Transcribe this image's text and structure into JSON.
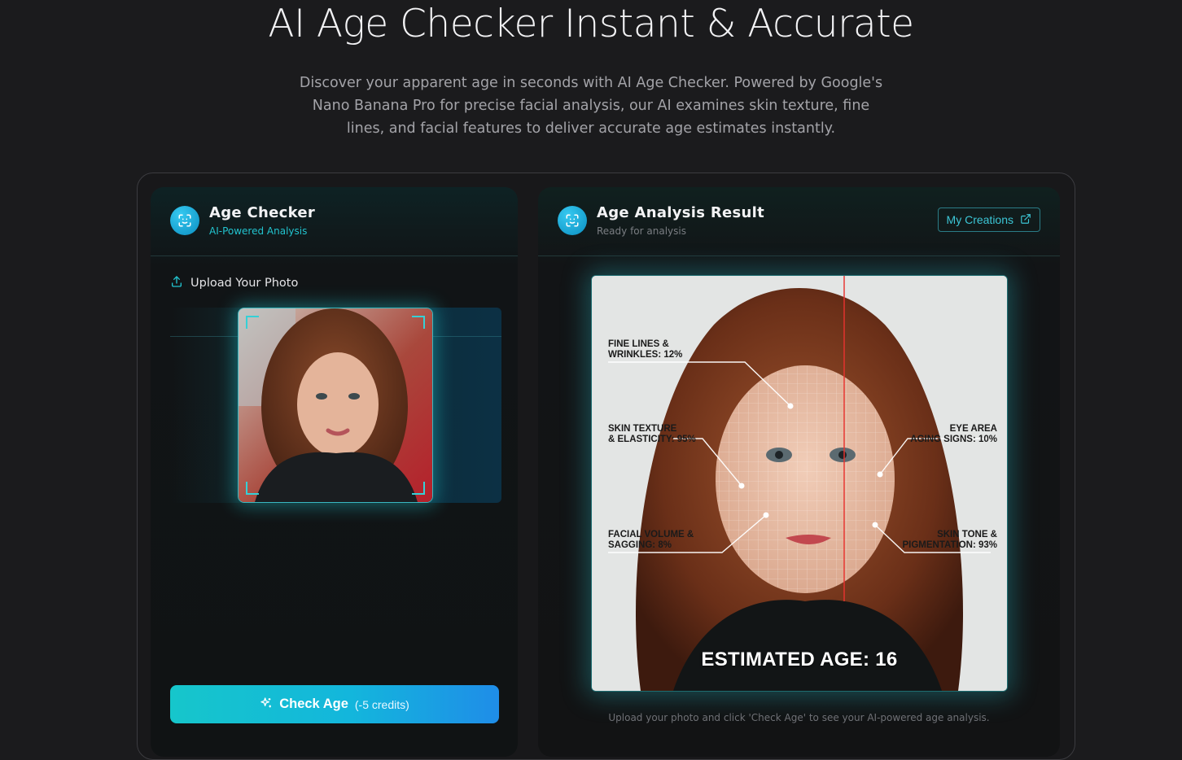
{
  "hero": {
    "title": "AI Age Checker Instant & Accurate",
    "description": "Discover your apparent age in seconds with AI Age Checker. Powered by Google's Nano Banana Pro for precise facial analysis, our AI examines skin texture, fine lines, and facial features to deliver accurate age estimates instantly."
  },
  "checker": {
    "icon": "face-scan-icon",
    "title": "Age Checker",
    "subtitle": "AI-Powered Analysis",
    "upload_label": "Upload Your Photo",
    "upload_icon": "upload-icon",
    "check_button": {
      "icon": "sparkles-icon",
      "label": "Check Age",
      "credits": "(-5 credits)"
    }
  },
  "result": {
    "icon": "face-scan-icon",
    "title": "Age Analysis Result",
    "status": "Ready for analysis",
    "my_creations": "My Creations",
    "my_creations_icon": "external-link-icon",
    "annotations": {
      "fine_lines": "FINE LINES &\nWRINKLES: 12%",
      "skin_texture": "SKIN TEXTURE\n& ELASTICITY: 95%",
      "eye_area": "EYE AREA\nAGING SIGNS: 10%",
      "facial_volume": "FACIAL VOLUME &\nSAGGING: 8%",
      "skin_tone": "SKIN TONE &\nPIGMENTATION: 93%"
    },
    "estimated_age": "ESTIMATED AGE: 16",
    "hint": "Upload your photo and click 'Check Age' to see your AI-powered age analysis."
  },
  "colors": {
    "accent": "#22c4cf",
    "background": "#1b1b1d",
    "scan_line": "#e8332f"
  }
}
